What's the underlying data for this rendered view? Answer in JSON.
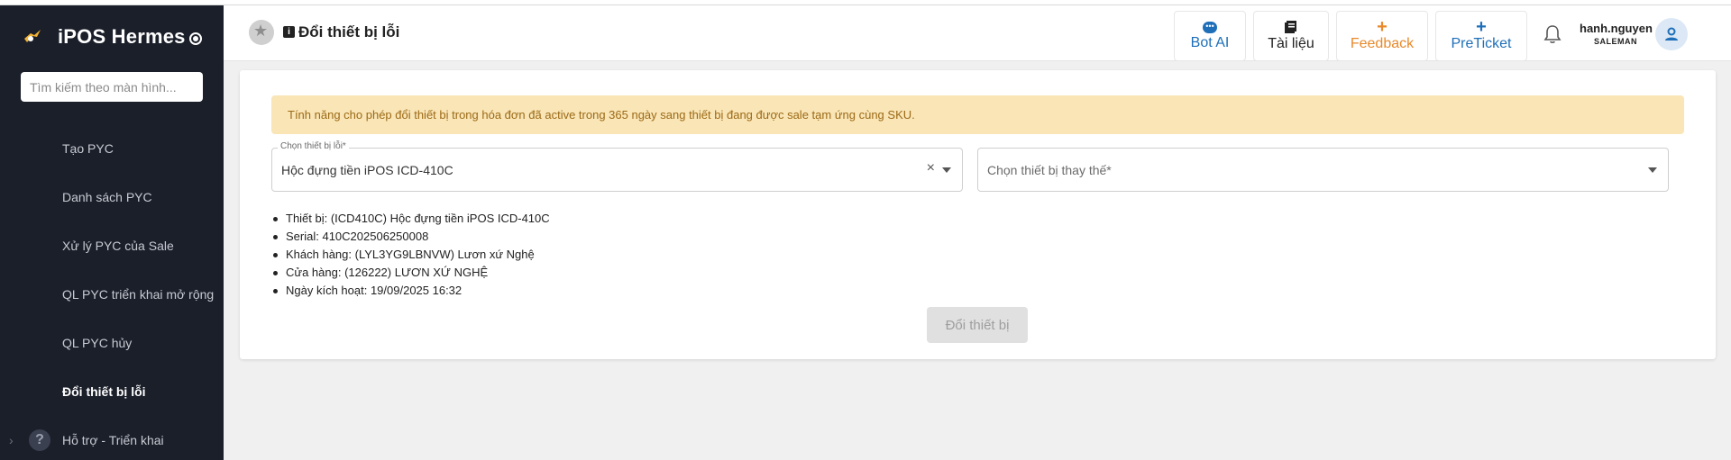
{
  "sidebar": {
    "brand": "iPOS Hermes",
    "search_placeholder": "Tìm kiếm theo màn hình...",
    "items": [
      {
        "label": "Tạo PYC"
      },
      {
        "label": "Danh sách PYC"
      },
      {
        "label": "Xử lý PYC của Sale"
      },
      {
        "label": "QL PYC triển khai mở rộng"
      },
      {
        "label": "QL PYC hủy"
      },
      {
        "label": "Đổi thiết bị lỗi",
        "active": true
      }
    ],
    "group": {
      "label": "Hỗ trợ - Triển khai",
      "icon": "help-circle-icon"
    }
  },
  "header": {
    "title": "Đổi thiết bị lỗi",
    "buttons": [
      {
        "label": "Bot AI",
        "icon": "chat-bubble-icon",
        "color": "#1e6fb8"
      },
      {
        "label": "Tài liệu",
        "icon": "book-icon",
        "color": "#222222"
      },
      {
        "label": "Feedback",
        "icon": "plus-icon",
        "color": "#e8892b"
      },
      {
        "label": "PreTicket",
        "icon": "plus-icon",
        "color": "#1e6fb8"
      }
    ],
    "user": {
      "name": "hanh.nguyen",
      "role": "SALEMAN"
    }
  },
  "main": {
    "notice": "Tính năng cho phép đổi thiết bị trong hóa đơn đã active trong 365 ngày sang thiết bị đang được sale tạm ứng cùng SKU.",
    "faulty_select": {
      "label": "Chọn thiết bị lỗi*",
      "value": "Hộc đựng tiền iPOS ICD-410C"
    },
    "replacement_select": {
      "placeholder": "Chọn thiết bị thay thế*"
    },
    "details": [
      "Thiết bị: (ICD410C) Hộc đựng tiền iPOS ICD-410C",
      "Serial: 410C202506250008",
      "Khách hàng: (LYL3YG9LBNVW) Lươn xứ Nghệ",
      "Cửa hàng: (126222) LƯƠN XỨ NGHỆ",
      "Ngày kích hoạt: 19/09/2025 16:32"
    ],
    "submit_label": "Đổi thiết bị"
  },
  "colors": {
    "sidebar_bg": "#1b1f2a",
    "notice_bg": "#f9e5b6",
    "notice_text": "#9c6a17",
    "accent_blue": "#1e6fb8",
    "accent_orange": "#e8892b"
  }
}
